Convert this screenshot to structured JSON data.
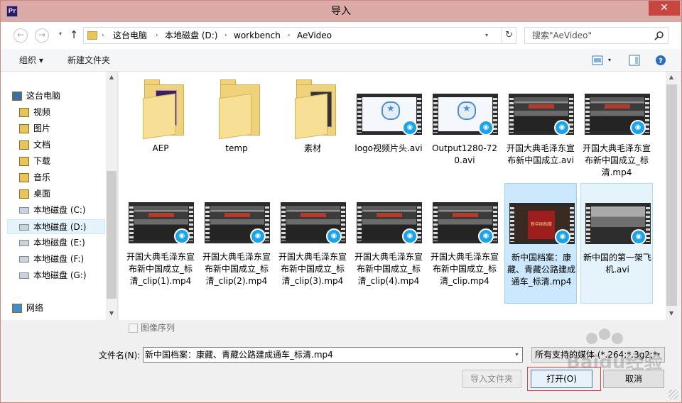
{
  "window": {
    "title": "导入",
    "app_icon_text": "Pr",
    "close_glyph": "✕"
  },
  "nav": {
    "back_glyph": "←",
    "forward_glyph": "→",
    "dropdown_glyph": "▾",
    "up_glyph": "↑",
    "refresh_glyph": "↻"
  },
  "address": {
    "crumbs": [
      "这台电脑",
      "本地磁盘 (D:)",
      "workbench",
      "AeVideo"
    ],
    "separator": "›",
    "dropdown_glyph": "▾"
  },
  "search": {
    "placeholder": "搜索\"AeVideo\""
  },
  "toolbar": {
    "organize_label": "组织 ▾",
    "new_folder_label": "新建文件夹",
    "view_drop_glyph": "▾",
    "help_glyph": "?"
  },
  "sidebar": {
    "items": [
      {
        "label": "这台电脑",
        "icon": "computer-icon",
        "selected": false
      },
      {
        "label": "视频",
        "icon": "video-library-icon",
        "selected": false
      },
      {
        "label": "图片",
        "icon": "pictures-library-icon",
        "selected": false
      },
      {
        "label": "文档",
        "icon": "documents-library-icon",
        "selected": false
      },
      {
        "label": "下载",
        "icon": "downloads-folder-icon",
        "selected": false
      },
      {
        "label": "音乐",
        "icon": "music-library-icon",
        "selected": false
      },
      {
        "label": "桌面",
        "icon": "desktop-folder-icon",
        "selected": false
      },
      {
        "label": "本地磁盘 (C:)",
        "icon": "system-drive-icon",
        "selected": false
      },
      {
        "label": "本地磁盘 (D:)",
        "icon": "drive-icon",
        "selected": true
      },
      {
        "label": "本地磁盘 (E:)",
        "icon": "drive-icon",
        "selected": false
      },
      {
        "label": "本地磁盘 (F:)",
        "icon": "drive-icon",
        "selected": false
      },
      {
        "label": "本地磁盘 (G:)",
        "icon": "drive-icon",
        "selected": false
      },
      {
        "label": "网络",
        "icon": "network-icon",
        "selected": false
      }
    ]
  },
  "files": [
    {
      "label": "AEP",
      "kind": "folder-ae"
    },
    {
      "label": "temp",
      "kind": "folder"
    },
    {
      "label": "素材",
      "kind": "folder-media"
    },
    {
      "label": "logo视频片头.avi",
      "kind": "video-logo"
    },
    {
      "label": "Output1280-720.avi",
      "kind": "video-logo"
    },
    {
      "label": "开国大典毛泽东宣布新中国成立.avi",
      "kind": "video-crowd"
    },
    {
      "label": "开国大典毛泽东宣布新中国成立_标清.mp4",
      "kind": "video-crowd"
    },
    {
      "label": "开国大典毛泽东宣布新中国成立_标清_clip(1).mp4",
      "kind": "video-crowd"
    },
    {
      "label": "开国大典毛泽东宣布新中国成立_标清_clip(2).mp4",
      "kind": "video-crowd"
    },
    {
      "label": "开国大典毛泽东宣布新中国成立_标清_clip(3).mp4",
      "kind": "video-crowd"
    },
    {
      "label": "开国大典毛泽东宣布新中国成立_标清_clip(4).mp4",
      "kind": "video-crowd"
    },
    {
      "label": "开国大典毛泽东宣布新中国成立_标清_clip.mp4",
      "kind": "video-crowd"
    },
    {
      "label": "新中国档案：康藏、青藏公路建成通车_标清.mp4",
      "kind": "video-book",
      "state": "selected"
    },
    {
      "label": "新中国的第一架飞机.avi",
      "kind": "video-gray",
      "state": "hover"
    }
  ],
  "bottom": {
    "image_sequence_label": "图像序列",
    "filename_label": "文件名(N):",
    "filename_value": "新中国档案：康藏、青藏公路建成通车_标清.mp4",
    "filetype_value": "所有支持的媒体 (*.264;*.3g2;*",
    "dropdown_glyph": "▾",
    "import_folder_label": "导入文件夹",
    "open_label": "打开(O)",
    "cancel_label": "取消"
  },
  "watermark": {
    "text": "Baidu经验"
  },
  "colors": {
    "titlebar": "#dcaaa6",
    "close": "#c7463f",
    "selection": "#cce8ff",
    "selection_border": "#99d1ff",
    "folder": "#f0d27b",
    "media_badge": "#1aa3e8"
  }
}
